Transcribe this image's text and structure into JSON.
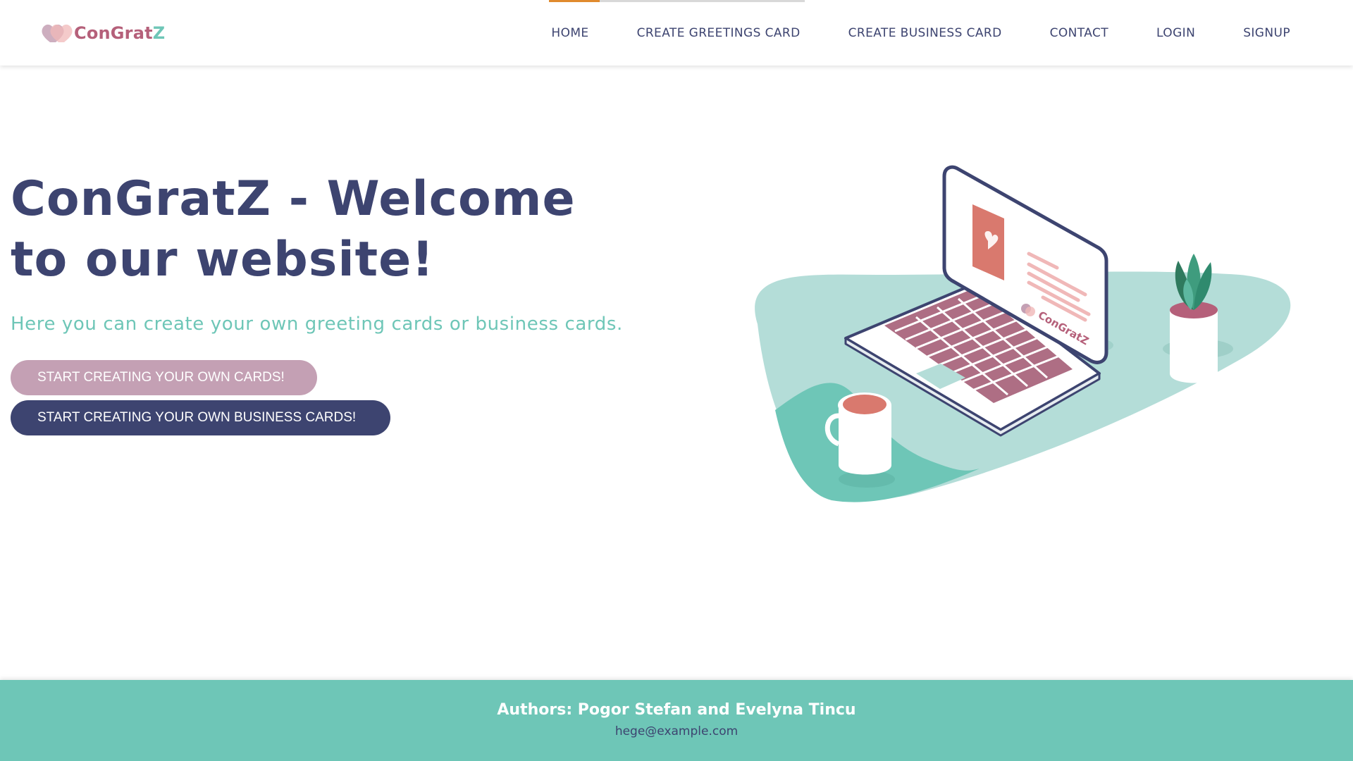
{
  "brand": {
    "name_part1": "ConGrat",
    "name_part2": "Z",
    "logo_icon": "hearts-logo-icon",
    "colors": {
      "navy": "#3d4470",
      "teal": "#6ec6b7",
      "rose": "#b5607a",
      "mauve": "#c4a0b4",
      "accent": "#e08a2e"
    }
  },
  "nav": {
    "items": [
      {
        "label": "HOME",
        "active": true
      },
      {
        "label": "CREATE GREETINGS CARD"
      },
      {
        "label": "CREATE BUSINESS CARD"
      },
      {
        "label": "CONTACT"
      },
      {
        "label": "LOGIN"
      },
      {
        "label": "SIGNUP"
      }
    ]
  },
  "hero": {
    "title": "ConGratZ - Welcome to our website!",
    "subtitle": "Here you can create your own greeting cards or business cards.",
    "button_cards": "START CREATING YOUR OWN CARDS!",
    "button_business": "START CREATING YOUR OWN BUSINESS CARDS!",
    "illustration": {
      "icon": "laptop-illustration",
      "screen_logo": "ConGratZ"
    }
  },
  "footer": {
    "authors": "Authors: Pogor Stefan and Evelyna Tincu",
    "email": "hege@example.com"
  }
}
